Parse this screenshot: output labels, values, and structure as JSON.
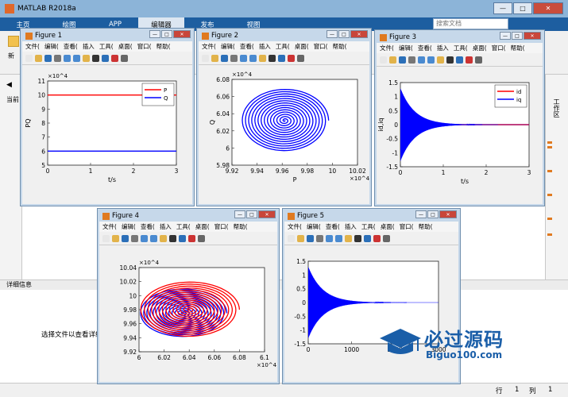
{
  "app": {
    "title": "MATLAB R2018a",
    "tabs": [
      "主页",
      "绘图",
      "APP",
      "编辑器",
      "发布",
      "视图"
    ],
    "search_placeholder": "搜索文档",
    "detail_header": "详细信息",
    "detail_message": "选择文件以查看详细",
    "current_folder_label": "当前",
    "new_label": "新",
    "workspace_label": "工作区",
    "status_row": "行",
    "status_row_value": "1",
    "status_col": "列",
    "status_col_value": "1"
  },
  "figure_menu": [
    "文件(",
    "编辑(",
    "查看(",
    "插入",
    "工具(",
    "桌面(",
    "窗口(",
    "帮助("
  ],
  "watermark": {
    "line1": "必过源码",
    "line2": "Biguo100.com"
  },
  "colors": {
    "p_series": "#ff0000",
    "q_series": "#0000ff",
    "matlab_orange": "#e07a20",
    "tab_blue": "#1d5ea0"
  },
  "figures": [
    {
      "title": "Figure 1",
      "chart_data": {
        "type": "line",
        "xlabel": "t/s",
        "ylabel": "PQ",
        "exponent": "×10^4",
        "xlim": [
          0,
          3
        ],
        "ylim": [
          5,
          11
        ],
        "xticks": [
          "0",
          "1",
          "2",
          "3"
        ],
        "yticks": [
          "5",
          "6",
          "7",
          "8",
          "9",
          "10",
          "11"
        ],
        "legend": "top-right",
        "series": [
          {
            "name": "P",
            "color": "#ff0000",
            "x": [
              0,
              3
            ],
            "y": [
              10,
              10
            ]
          },
          {
            "name": "Q",
            "color": "#0000ff",
            "x": [
              0,
              3
            ],
            "y": [
              6,
              6
            ]
          }
        ]
      }
    },
    {
      "title": "Figure 2",
      "chart_data": {
        "type": "line",
        "xlabel": "P",
        "ylabel": "Q",
        "exponent_x": "×10^4",
        "exponent_y": "×10^4",
        "xlim": [
          9.92,
          10.02
        ],
        "ylim": [
          5.98,
          6.08
        ],
        "xticks": [
          "9.92",
          "9.94",
          "9.96",
          "9.98",
          "10",
          "10.02"
        ],
        "yticks": [
          "5.98",
          "6",
          "6.02",
          "6.04",
          "6.06",
          "6.08"
        ],
        "series": [
          {
            "name": "",
            "color": "#0000ff",
            "shape": "spiral",
            "center": [
              9.962,
              6.032
            ],
            "r_max": [
              0.035,
              0.037
            ]
          }
        ]
      }
    },
    {
      "title": "Figure 3",
      "chart_data": {
        "type": "line",
        "xlabel": "t/s",
        "ylabel": "id,iq",
        "xlim": [
          0,
          3
        ],
        "ylim": [
          -1.5,
          1.5
        ],
        "xticks": [
          "0",
          "1",
          "2",
          "3"
        ],
        "yticks": [
          "-1.5",
          "-1",
          "-0.5",
          "0",
          "0.5",
          "1",
          "1.5"
        ],
        "legend": "top-right",
        "series": [
          {
            "name": "id",
            "color": "#ff0000",
            "x": [
              0,
              3
            ],
            "y": [
              0,
              0
            ]
          },
          {
            "name": "iq",
            "color": "#0000ff",
            "shape": "decaying-oscillation",
            "x_start": 0,
            "x_end": 3,
            "amplitude": 1.3
          }
        ]
      }
    },
    {
      "title": "Figure 4",
      "chart_data": {
        "type": "line",
        "xlabel": "",
        "ylabel": "",
        "exponent_x": "×10^4",
        "exponent_y": "×10^4",
        "xlim": [
          6,
          6.1
        ],
        "ylim": [
          9.92,
          10.04
        ],
        "xticks": [
          "6",
          "6.02",
          "6.04",
          "6.06",
          "6.08",
          "6.1"
        ],
        "yticks": [
          "9.92",
          "9.94",
          "9.96",
          "9.98",
          "10",
          "10.02",
          "10.04"
        ],
        "series": [
          {
            "name": "",
            "color": "#0000ff",
            "shape": "spiral",
            "center": [
              6.035,
              9.975
            ],
            "r_max": [
              0.035,
              0.035
            ]
          },
          {
            "name": "",
            "color": "#ff0000",
            "shape": "spiral",
            "center": [
              6.04,
              9.98
            ],
            "r_max": [
              0.04,
              0.04
            ]
          }
        ]
      }
    },
    {
      "title": "Figure 5",
      "chart_data": {
        "type": "line",
        "xlabel": "",
        "ylabel": "",
        "xlim": [
          0,
          3000
        ],
        "ylim": [
          -1.5,
          1.5
        ],
        "xticks": [
          "0",
          "1000",
          "2000",
          "3000"
        ],
        "yticks": [
          "-1.5",
          "-1",
          "-0.5",
          "0",
          "0.5",
          "1",
          "1.5"
        ],
        "series": [
          {
            "name": "",
            "color": "#0000ff",
            "shape": "decaying-oscillation",
            "x_start": 0,
            "x_end": 3000,
            "amplitude": 1.3
          }
        ]
      }
    }
  ]
}
